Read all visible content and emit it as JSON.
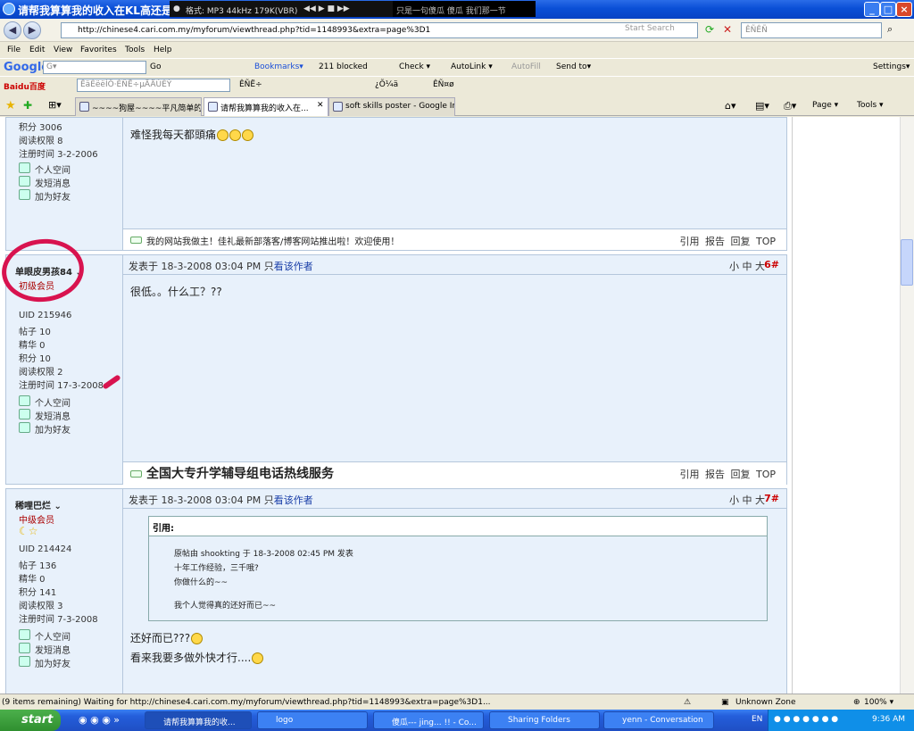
{
  "window": {
    "title": "请帮我算算我的收入在KL高还是",
    "media_format": "格式: MP3 44kHz 179K(VBR)",
    "media_title": "只是一句傻瓜    傻瓜 我们那一节"
  },
  "address": {
    "url": "http://chinese4.cari.com.my/myforum/viewthread.php?tid=1148993&extra=page%3D1",
    "search_placeholder": "Start Search",
    "search_box": "ÊÑÊÑ"
  },
  "menu": [
    "File",
    "Edit",
    "View",
    "Favorites",
    "Tools",
    "Help"
  ],
  "google_toolbar": {
    "logo": "Google",
    "go": "Go",
    "bookmarks": "Bookmarks▾",
    "blocked": "211 blocked",
    "check": "Check ▾",
    "autolink": "AutoLink ▾",
    "autofill": "AutoFill",
    "sendto": "Send to▾",
    "settings": "Settings▾"
  },
  "baidu_toolbar": {
    "logo": "Baidu百度",
    "input": "ÊäÈëëÍÔ·ÈÑË÷µÄÄÚÈÝ",
    "search": "ÊÑË÷",
    "item1": "¿Õ¼ä",
    "item2": "ÊÑ¤ø"
  },
  "tabs": [
    {
      "label": "~~~~狗屋~~~~平凡简单的..."
    },
    {
      "label": "请帮我算算我的收入在..."
    },
    {
      "label": "soft skills poster - Google Im..."
    }
  ],
  "commandbar": {
    "page": "Page ▾",
    "tools": "Tools ▾"
  },
  "post_prev": {
    "stat_top": "积分  3006",
    "read_perm": "阅读权限  8",
    "reg_date": "注册时间  3-2-2006",
    "link_space": "个人空间",
    "link_msg": "发短消息",
    "link_friend": "加为好友",
    "text": "难怪我每天都頭痛",
    "footer_ad": "我的网站我做主！佳礼最新部落客/博客网站推出啦！欢迎使用！",
    "actions": "引用  报告  回复  TOP"
  },
  "post6": {
    "username": "单眼皮男孩84 ⌄",
    "level": "初级会员",
    "uid": "UID  215946",
    "posts": "帖子  10",
    "digest": "精华  0",
    "credits": "积分  10",
    "read_perm": "阅读权限  2",
    "reg_date": "注册时间  17-3-2008",
    "link_space": "个人空间",
    "link_msg": "发短消息",
    "link_friend": "加为好友",
    "time_prefix": "发表于  18-3-2008 03:04 PM 只",
    "author_only": "看该作者",
    "size": "小 中 大",
    "num": "6#",
    "text": "很低。。什么工？??",
    "footer_ad": "全国大专升学辅导组电话热线服务",
    "actions": "引用  报告  回复  TOP"
  },
  "post7": {
    "username": "稀哩巴烂 ⌄",
    "level": "中级会员",
    "uid": "UID  214424",
    "posts": "帖子  136",
    "digest": "精华  0",
    "credits": "积分  141",
    "read_perm": "阅读权限  3",
    "reg_date": "注册时间  7-3-2008",
    "link_space": "个人空间",
    "link_msg": "发短消息",
    "link_friend": "加为好友",
    "time_prefix": "发表于  18-3-2008 03:04 PM 只",
    "author_only": "看该作者",
    "size": "小 中 大",
    "num": "7#",
    "quote_header": "引用:",
    "quote_line1": "原帖由 shookting 于 18-3-2008 02:45 PM 发表",
    "quote_line2": "十年工作经验，三千哦?",
    "quote_line3": "你做什么的~~",
    "quote_line4": "我个人觉得真的还好而已~~",
    "text1": "还好而已???",
    "text2": "看来我要多做外快才行...."
  },
  "status": {
    "text": "(9 items remaining) Waiting for http://chinese4.cari.com.my/myforum/viewthread.php?tid=1148993&extra=page%3D1...",
    "zone": "Unknown Zone",
    "zoom": "100% ▾"
  },
  "taskbar": {
    "start": "start",
    "tasks": [
      "请帮我算算我的收...",
      "logo",
      "傻瓜--- jing... !! - Co...",
      "Sharing Folders",
      "yenn - Conversation"
    ],
    "lang": "EN",
    "clock": "9:36 AM"
  }
}
